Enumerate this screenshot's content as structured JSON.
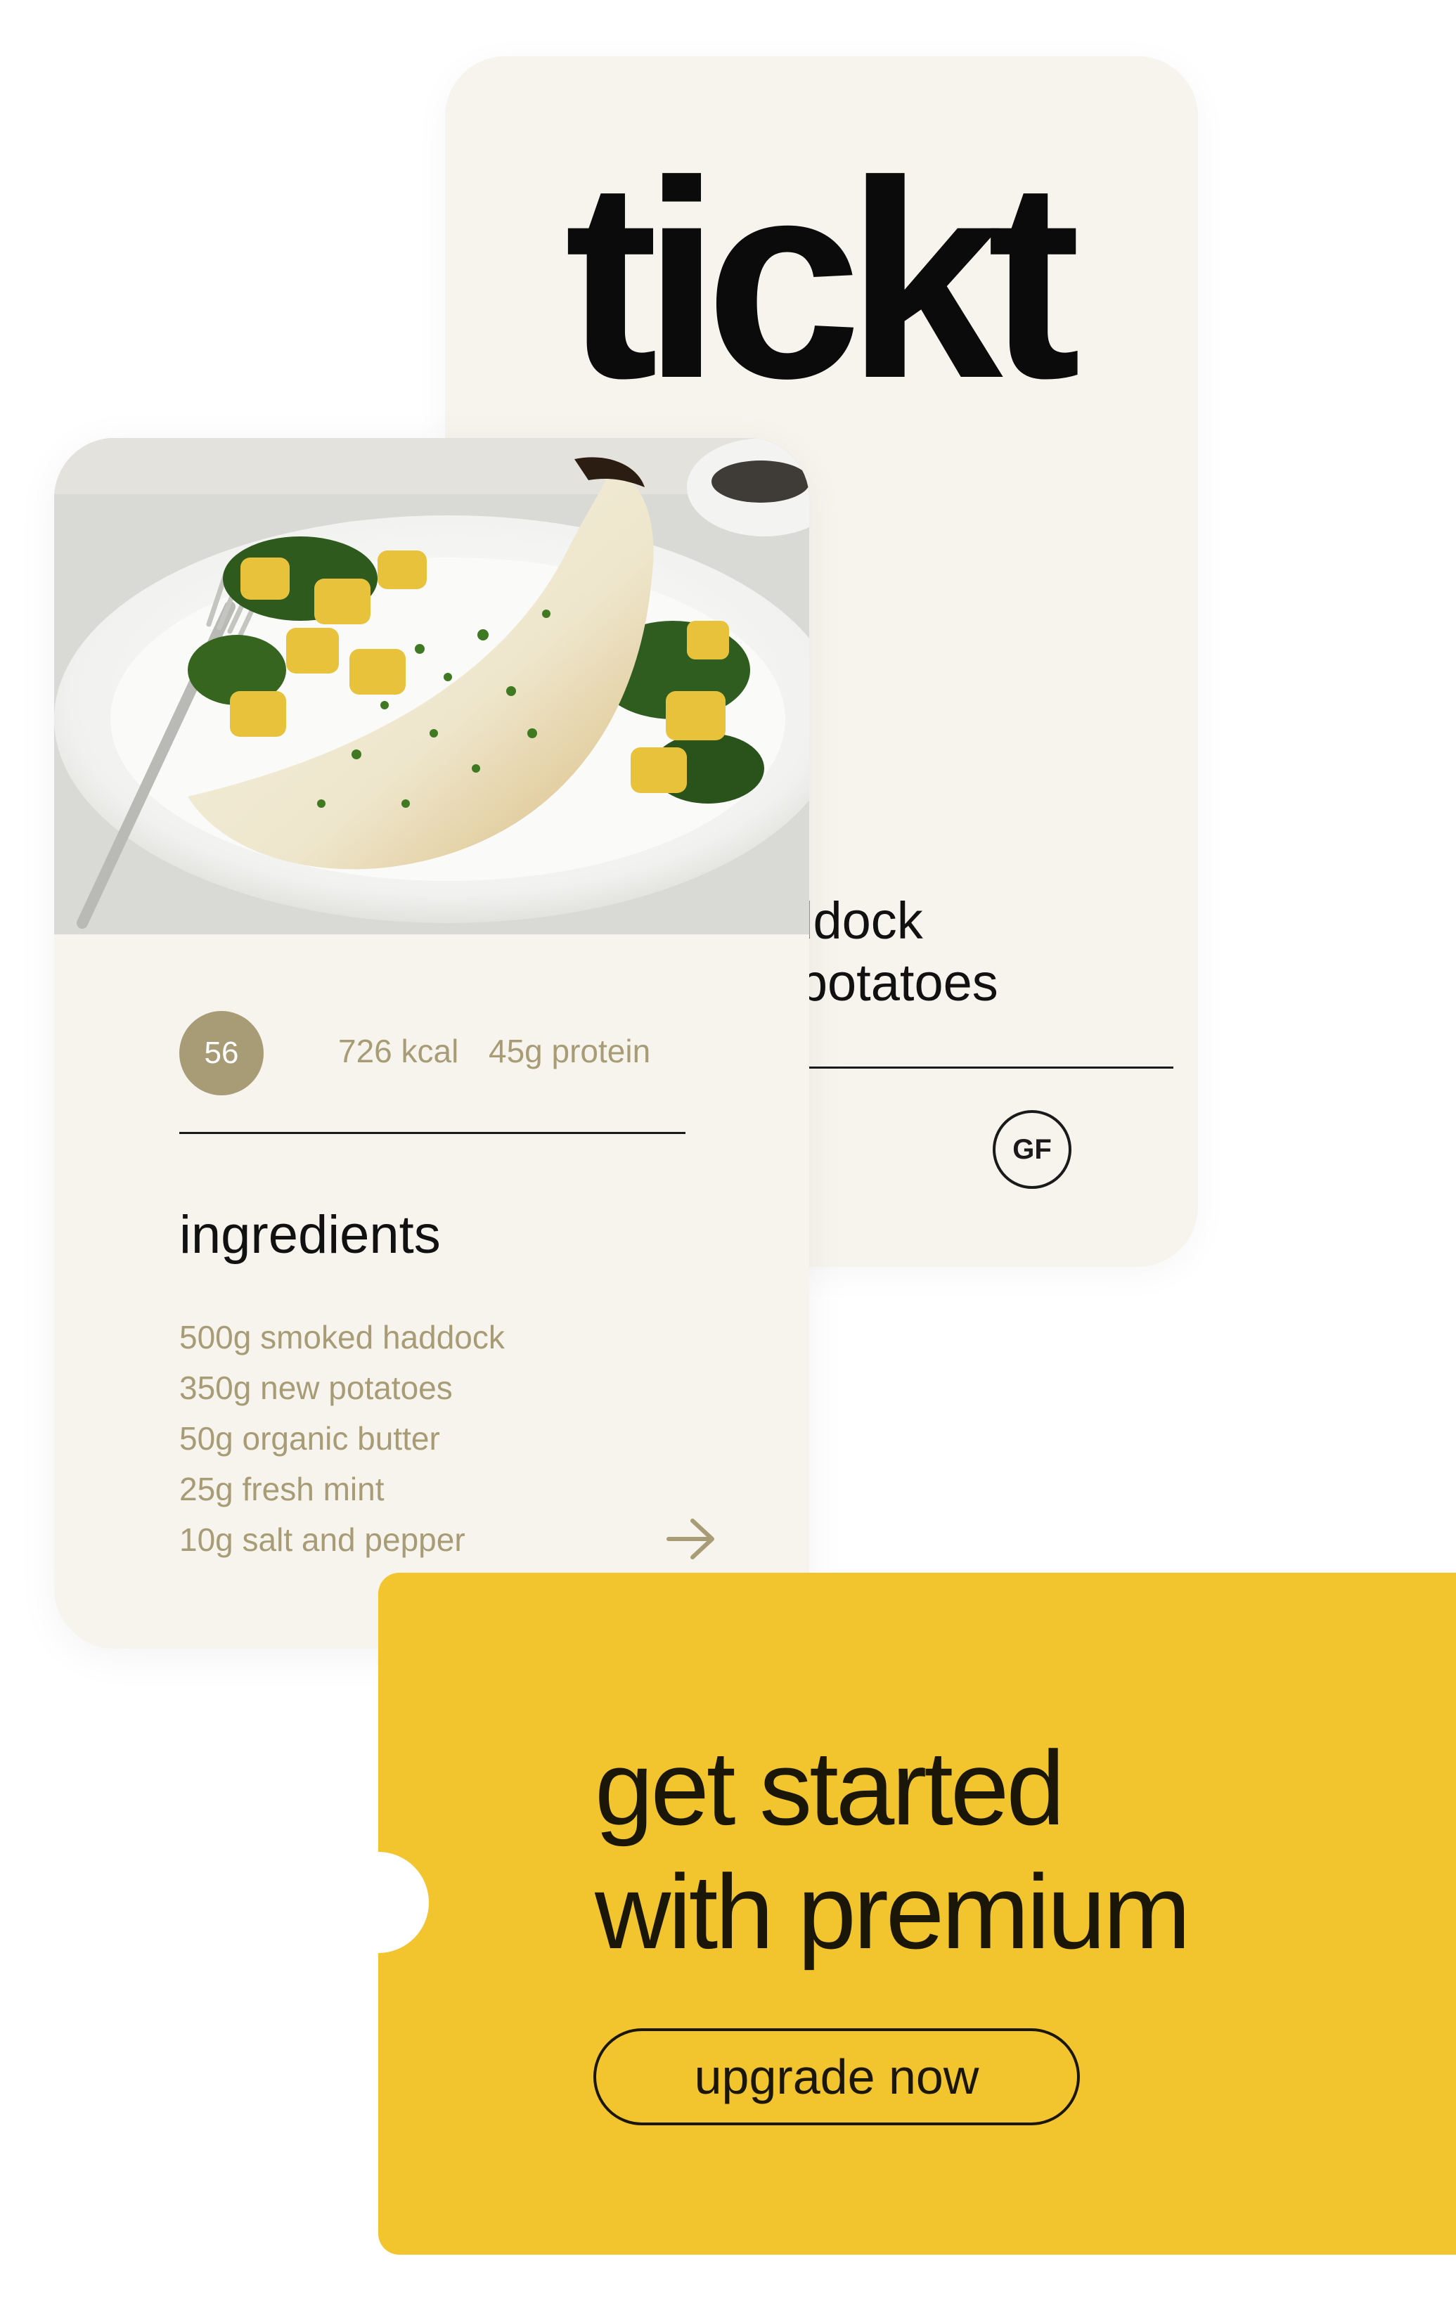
{
  "colors": {
    "card_background": "#f7f4ee",
    "accent_olive": "#a79c76",
    "premium_yellow": "#f2c42e",
    "text_dark": "#111111"
  },
  "back_card": {
    "brand": "tickt",
    "recipe_title_line1": "haddock",
    "recipe_title_line2": "ed potatoes",
    "diet_badge": "GF"
  },
  "recipe_card": {
    "photo_icon": "plated-fish-with-potatoes-photo",
    "score": "56",
    "calories": "726 kcal",
    "protein": "45g protein",
    "ingredients_title": "ingredients",
    "ingredients": [
      "500g smoked haddock",
      "350g new potatoes",
      "50g organic butter",
      "25g fresh mint",
      "10g salt and pepper"
    ],
    "next_icon": "arrow-right-icon"
  },
  "premium": {
    "title_line1": "get started",
    "title_line2": "with premium",
    "button_label": "upgrade now"
  }
}
